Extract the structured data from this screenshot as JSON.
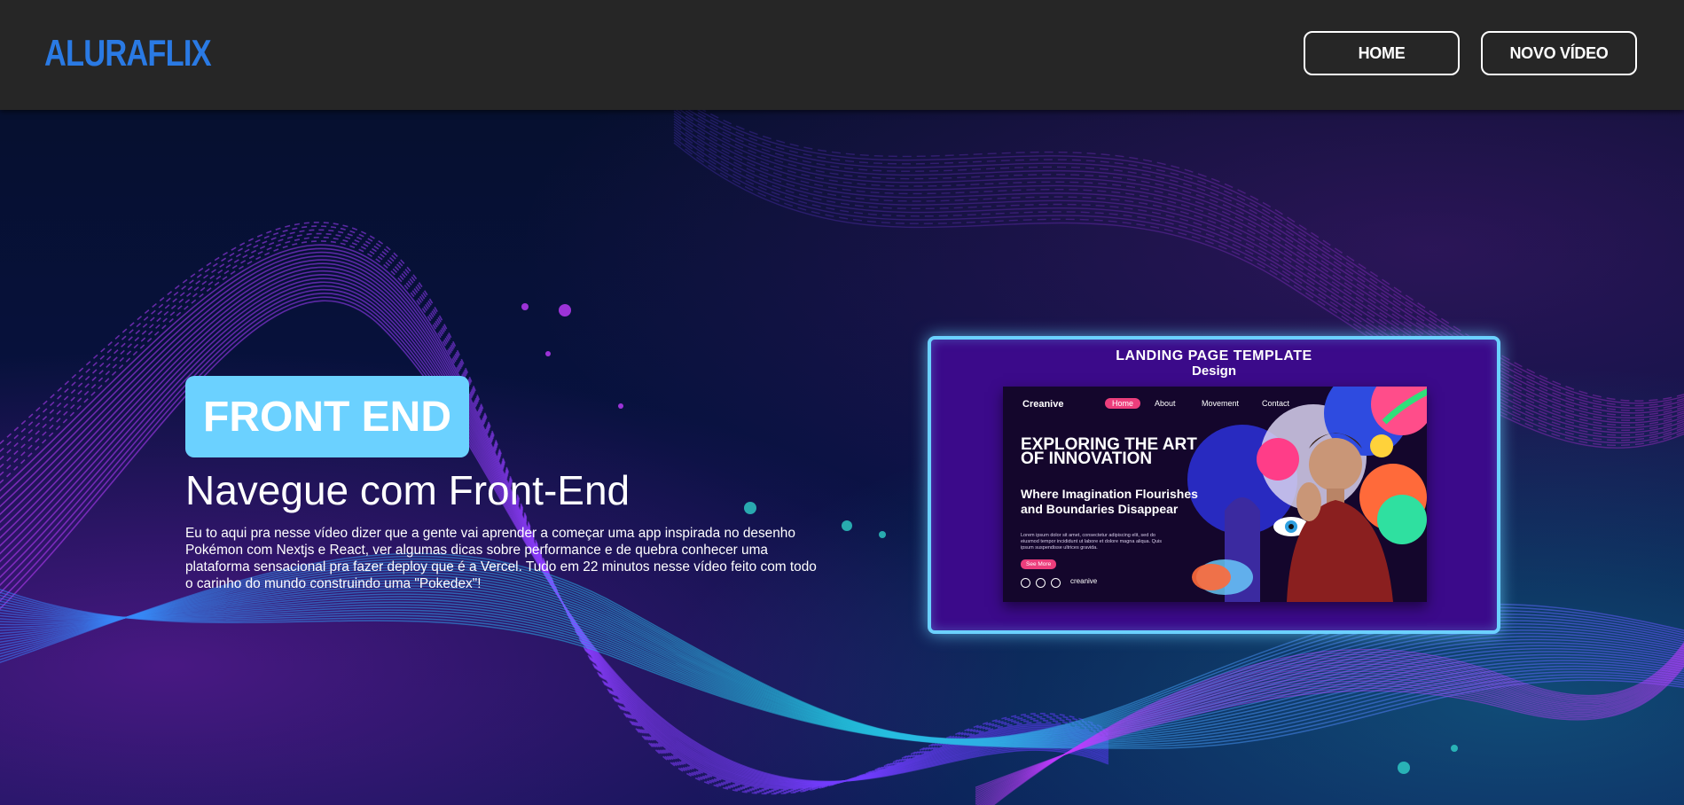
{
  "header": {
    "logo": "ALURAFLIX",
    "nav": [
      {
        "label": "HOME"
      },
      {
        "label": "NOVO VÍDEO"
      }
    ]
  },
  "hero": {
    "category": "FRONT END",
    "title": "Navegue com Front-End",
    "description": "Eu to aqui pra nesse vídeo dizer que a gente vai aprender a começar uma app inspirada no desenho Pokémon com Nextjs e React, ver algumas dicas sobre performance e de quebra conhecer uma plataforma sensacional pra fazer deploy que é a Vercel. Tudo em 22 minutos nesse vídeo feito com todo o carinho do mundo construindo uma \"Pokedex\"!",
    "accent_color": "#6bd1ff"
  },
  "video": {
    "thumb_title": "LANDING PAGE TEMPLATE",
    "thumb_subtitle": "Design",
    "mock": {
      "brand": "Creanive",
      "nav": [
        "Home",
        "About",
        "Movement",
        "Contact"
      ],
      "headline": "EXPLORING THE ART OF INNOVATION",
      "subheadline": "Where Imagination Flourishes and Boundaries Disappear",
      "body": "Lorem ipsum dolor sit amet, consectetur adipiscing elit, sed do eiusmod tempor incididunt ut labore et dolore magna aliqua. Quis ipsum suspendisse ultrices gravida.",
      "cta": "See More",
      "handle": "creanive"
    }
  },
  "colors": {
    "header_bg": "#262626",
    "logo": "#2a7ae4",
    "card_border": "#6bd1ff"
  }
}
